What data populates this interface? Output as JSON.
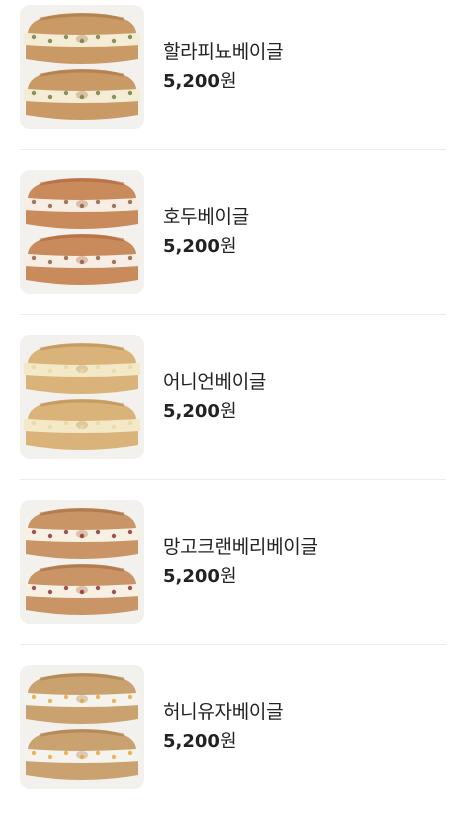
{
  "menu": {
    "items": [
      {
        "name": "할라피뇨베이글",
        "price": "5,200",
        "currency": "원",
        "image_icon": "jalapeno-bagel-image",
        "colors": {
          "crust": "#c99a66",
          "crust_dark": "#a87445",
          "filling": "#f4ecd4",
          "speck": "#6b7a3a"
        }
      },
      {
        "name": "호두베이글",
        "price": "5,200",
        "currency": "원",
        "image_icon": "walnut-bagel-image",
        "colors": {
          "crust": "#c98a5c",
          "crust_dark": "#b0663e",
          "filling": "#f6eee4",
          "speck": "#8a5a3a"
        }
      },
      {
        "name": "어니언베이글",
        "price": "5,200",
        "currency": "원",
        "image_icon": "onion-bagel-image",
        "colors": {
          "crust": "#d9b37a",
          "crust_dark": "#b88d52",
          "filling": "#f3e9c6",
          "speck": "#e8d7a4"
        }
      },
      {
        "name": "망고크랜베리베이글",
        "price": "5,200",
        "currency": "원",
        "image_icon": "mango-cranberry-bagel-image",
        "colors": {
          "crust": "#c99466",
          "crust_dark": "#a56c40",
          "filling": "#f7f1e4",
          "speck": "#8c2a2a"
        }
      },
      {
        "name": "허니유자베이글",
        "price": "5,200",
        "currency": "원",
        "image_icon": "honey-yuzu-bagel-image",
        "colors": {
          "crust": "#c9a270",
          "crust_dark": "#a87c4a",
          "filling": "#f5f3ee",
          "speck": "#e9a33a"
        }
      }
    ]
  }
}
